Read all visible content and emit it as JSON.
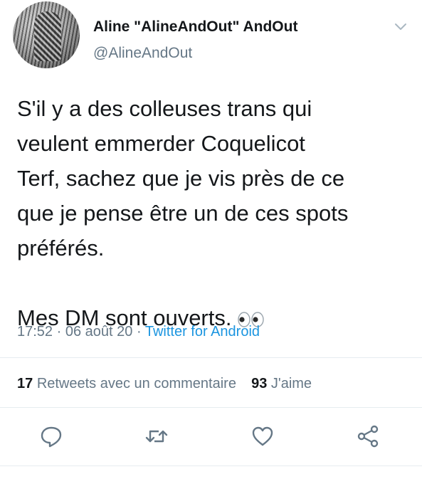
{
  "author": {
    "display_name": "Aline \"AlineAndOut\" AndOut",
    "handle": "@AlineAndOut"
  },
  "tweet": {
    "lines": [
      "S'il y a des colleuses trans qui",
      "veulent emmerder Coquelicot",
      "Terf, sachez que je vis près de ce",
      "que je pense être un de ces spots",
      "préférés."
    ],
    "last_line": "Mes DM sont ouverts.",
    "emoji": "eyes-emoji"
  },
  "meta": {
    "time": "17:52",
    "separator": "·",
    "date": "06 août 20",
    "source": "Twitter for Android"
  },
  "stats": {
    "retweets_count": "17",
    "retweets_label": "Retweets avec un commentaire",
    "likes_count": "93",
    "likes_label": "J'aime"
  },
  "actions": [
    "reply-icon",
    "retweet-icon",
    "like-icon",
    "share-icon"
  ],
  "colors": {
    "text": "#14171a",
    "secondary": "#657786",
    "link": "#1b95e0",
    "divider": "#e6ecf0"
  }
}
